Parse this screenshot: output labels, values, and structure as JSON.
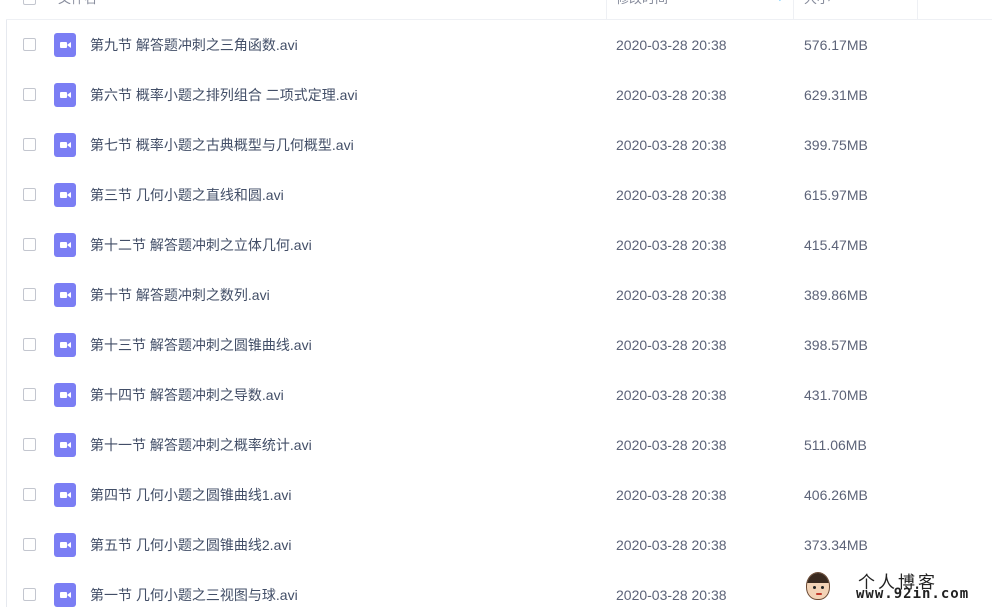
{
  "header": {
    "name_label": "文件名",
    "modified_label": "修改时间",
    "size_label": "大小"
  },
  "files": [
    {
      "name": "第九节 解答题冲刺之三角函数.avi",
      "modified": "2020-03-28 20:38",
      "size": "576.17MB"
    },
    {
      "name": "第六节 概率小题之排列组合 二项式定理.avi",
      "modified": "2020-03-28 20:38",
      "size": "629.31MB"
    },
    {
      "name": "第七节 概率小题之古典概型与几何概型.avi",
      "modified": "2020-03-28 20:38",
      "size": "399.75MB"
    },
    {
      "name": "第三节 几何小题之直线和圆.avi",
      "modified": "2020-03-28 20:38",
      "size": "615.97MB"
    },
    {
      "name": "第十二节 解答题冲刺之立体几何.avi",
      "modified": "2020-03-28 20:38",
      "size": "415.47MB"
    },
    {
      "name": "第十节 解答题冲刺之数列.avi",
      "modified": "2020-03-28 20:38",
      "size": "389.86MB"
    },
    {
      "name": "第十三节 解答题冲刺之圆锥曲线.avi",
      "modified": "2020-03-28 20:38",
      "size": "398.57MB"
    },
    {
      "name": "第十四节 解答题冲刺之导数.avi",
      "modified": "2020-03-28 20:38",
      "size": "431.70MB"
    },
    {
      "name": "第十一节 解答题冲刺之概率统计.avi",
      "modified": "2020-03-28 20:38",
      "size": "511.06MB"
    },
    {
      "name": "第四节 几何小题之圆锥曲线1.avi",
      "modified": "2020-03-28 20:38",
      "size": "406.26MB"
    },
    {
      "name": "第五节 几何小题之圆锥曲线2.avi",
      "modified": "2020-03-28 20:38",
      "size": "373.34MB"
    },
    {
      "name": "第一节 几何小题之三视图与球.avi",
      "modified": "2020-03-28 20:38",
      "size": ""
    }
  ],
  "icons": {
    "file_type": "video-file-icon",
    "sort": "sort-arrow-down-icon",
    "video_color": "#7b7ef4",
    "sort_color": "#06a7ff"
  },
  "watermark": {
    "title": "个人博客",
    "url": "www.92in.com"
  }
}
